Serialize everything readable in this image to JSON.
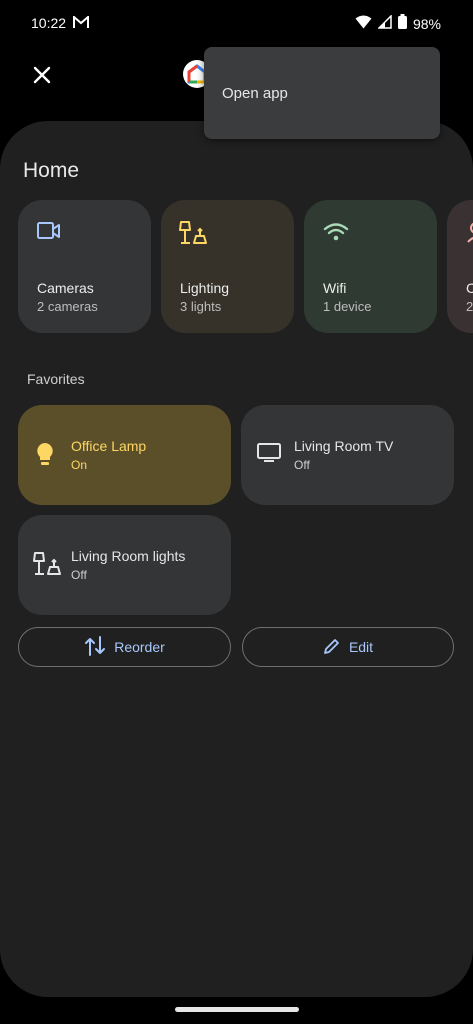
{
  "status_bar": {
    "time": "10:22",
    "battery": "98%"
  },
  "sheet": {
    "title": "Home"
  },
  "tiles": [
    {
      "name": "Cameras",
      "sub": "2 cameras",
      "icon": "camera-icon",
      "bg": "#333537"
    },
    {
      "name": "Lighting",
      "sub": "3 lights",
      "icon": "lamp-icon",
      "bg": "#36322a"
    },
    {
      "name": "Wifi",
      "sub": "1 device",
      "icon": "wifi-icon",
      "bg": "#2f3a33"
    },
    {
      "name": "C",
      "sub": "2",
      "icon": "partial-icon",
      "bg": "#3a3232"
    }
  ],
  "favorites": {
    "label": "Favorites",
    "items": [
      {
        "name": "Office Lamp",
        "state": "On",
        "icon": "bulb-icon",
        "active": true
      },
      {
        "name": "Living Room TV",
        "state": "Off",
        "icon": "tv-icon",
        "active": false
      },
      {
        "name": "Living Room lights",
        "state": "Off",
        "icon": "lamp-icon",
        "active": false
      }
    ]
  },
  "actions": {
    "reorder": "Reorder",
    "edit": "Edit"
  },
  "menu": {
    "open_app": "Open app"
  },
  "colors": {
    "accent_blue": "#a8c7fa",
    "active_yellow": "#fdd663",
    "active_card": "#5b4f2a"
  }
}
